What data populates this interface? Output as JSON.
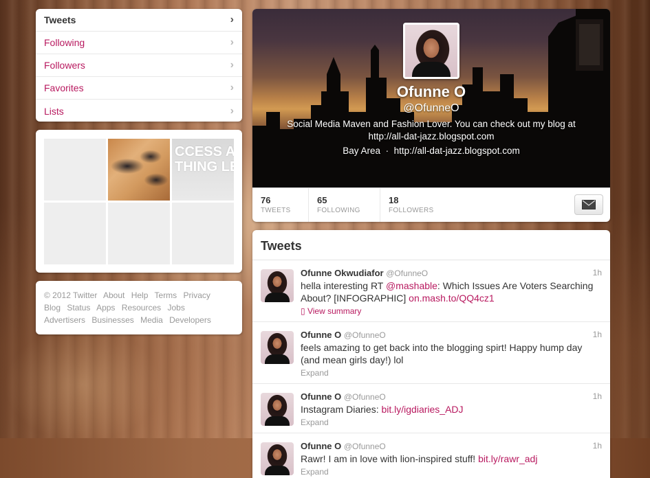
{
  "nav": {
    "items": [
      {
        "label": "Tweets",
        "active": true
      },
      {
        "label": "Following",
        "active": false
      },
      {
        "label": "Followers",
        "active": false
      },
      {
        "label": "Favorites",
        "active": false
      },
      {
        "label": "Lists",
        "active": false
      }
    ]
  },
  "media": {
    "text_tile": "CCESS AN\nTHING LE"
  },
  "footer": {
    "links": [
      "© 2012 Twitter",
      "About",
      "Help",
      "Terms",
      "Privacy",
      "Blog",
      "Status",
      "Apps",
      "Resources",
      "Jobs",
      "Advertisers",
      "Businesses",
      "Media",
      "Developers"
    ]
  },
  "profile": {
    "name": "Ofunne O",
    "handle": "@OfunneO",
    "bio": "Social Media Maven and Fashion Lover. You can check out my blog at http://all-dat-jazz.blogspot.com",
    "location": "Bay Area",
    "separator": "·",
    "url": "http://all-dat-jazz.blogspot.com",
    "stats": [
      {
        "num": "76",
        "label": "TWEETS"
      },
      {
        "num": "65",
        "label": "FOLLOWING"
      },
      {
        "num": "18",
        "label": "FOLLOWERS"
      }
    ]
  },
  "tweets": {
    "title": "Tweets",
    "items": [
      {
        "name": "Ofunne Okwudiafor",
        "handle": "@OfunneO",
        "time": "1h",
        "text_before": "hella interesting RT ",
        "mention": "@mashable",
        "text_after": ": Which Issues Are Voters Searching About? [INFOGRAPHIC] ",
        "link": "on.mash.to/QQ4cz1",
        "action": "View summary"
      },
      {
        "name": "Ofunne O",
        "handle": "@OfunneO",
        "time": "1h",
        "text": "feels amazing to get back into the blogging spirt! Happy hump day (and mean girls day!) lol",
        "action": "Expand"
      },
      {
        "name": "Ofunne O",
        "handle": "@OfunneO",
        "time": "1h",
        "text": "Instagram Diaries: ",
        "link": "bit.ly/igdiaries_ADJ",
        "action": "Expand"
      },
      {
        "name": "Ofunne O",
        "handle": "@OfunneO",
        "time": "1h",
        "text": "Rawr! I am in love with lion-inspired stuff! ",
        "link": "bit.ly/rawr_adj",
        "action": "Expand"
      }
    ]
  }
}
